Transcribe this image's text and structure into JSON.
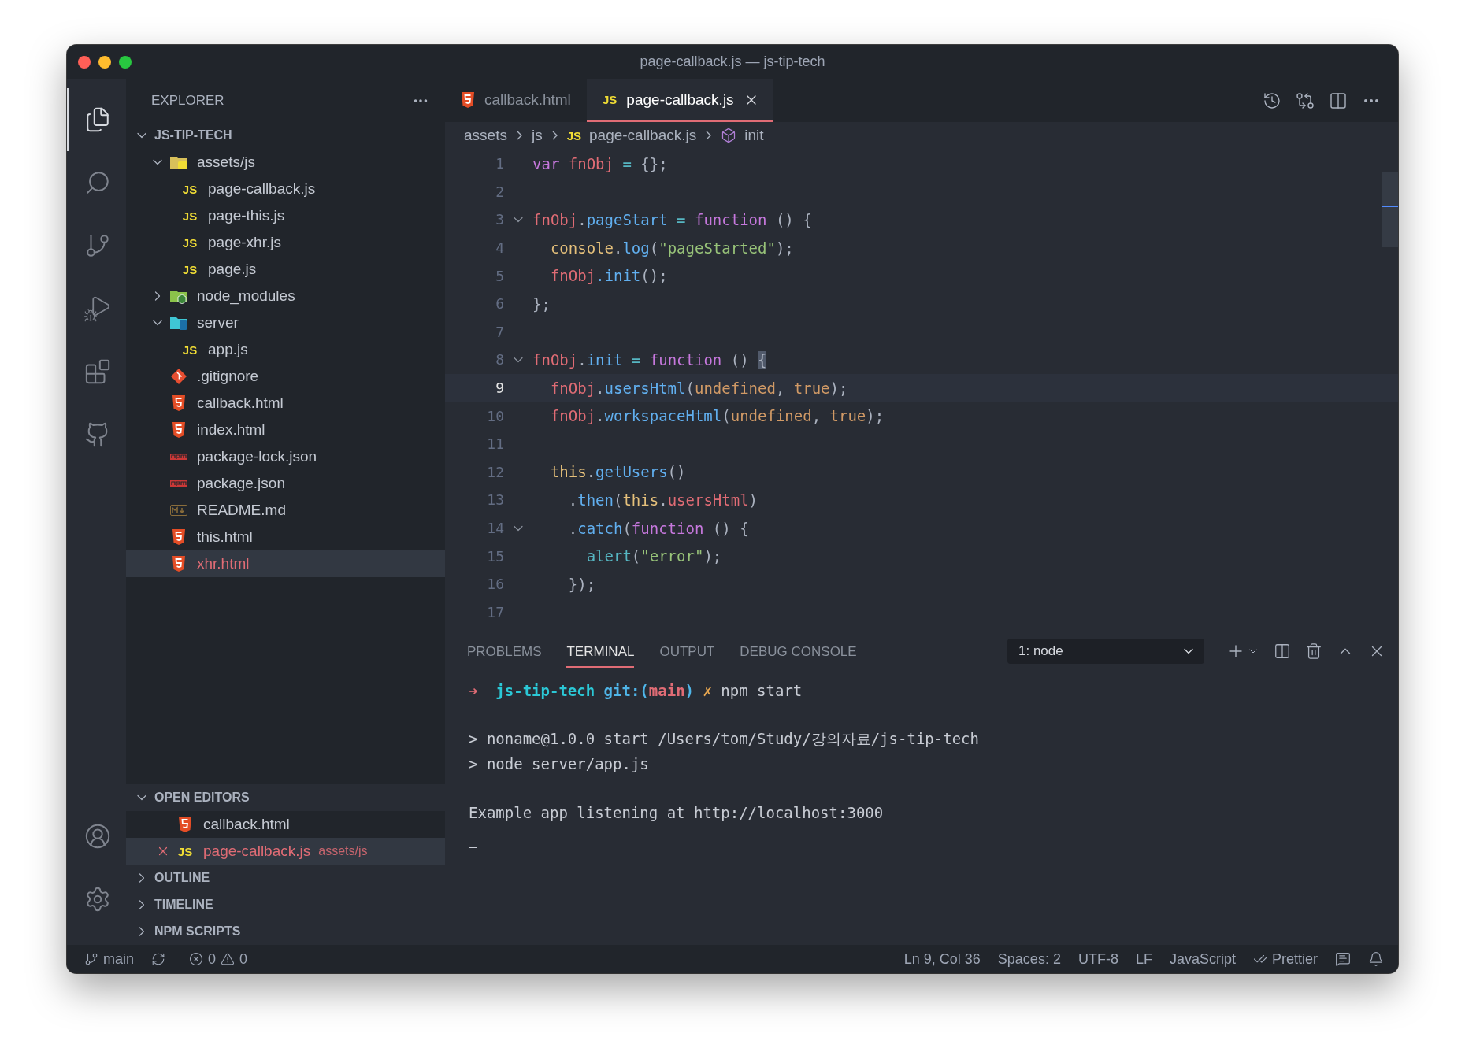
{
  "window": {
    "title": "page-callback.js — js-tip-tech"
  },
  "activity_bar": {
    "items": [
      {
        "kind": "explorer",
        "selected": true
      },
      {
        "kind": "search",
        "selected": false
      },
      {
        "kind": "source-control",
        "selected": false
      },
      {
        "kind": "run-debug",
        "selected": false
      },
      {
        "kind": "extensions",
        "selected": false
      },
      {
        "kind": "github",
        "selected": false
      }
    ],
    "bottom": [
      {
        "kind": "account"
      },
      {
        "kind": "settings"
      }
    ]
  },
  "sidebar": {
    "title": "EXPLORER",
    "root": {
      "label": "JS-TIP-TECH",
      "expanded": true
    },
    "tree": [
      {
        "label": "assets/js",
        "kind": "folder-js",
        "expanded": true,
        "selected": false,
        "errors": false,
        "children": [
          {
            "label": "page-callback.js",
            "kind": "js",
            "icon_label": "JS",
            "selected": false,
            "errors": false
          },
          {
            "label": "page-this.js",
            "kind": "js",
            "icon_label": "JS",
            "selected": false,
            "errors": false
          },
          {
            "label": "page-xhr.js",
            "kind": "js",
            "icon_label": "JS",
            "selected": false,
            "errors": false
          },
          {
            "label": "page.js",
            "kind": "js",
            "icon_label": "JS",
            "selected": false,
            "errors": false
          }
        ]
      },
      {
        "label": "node_modules",
        "kind": "folder-node",
        "expanded": false,
        "selected": false,
        "errors": false
      },
      {
        "label": "server",
        "kind": "folder-server",
        "expanded": true,
        "selected": false,
        "errors": false,
        "children": [
          {
            "label": "app.js",
            "kind": "js",
            "icon_label": "JS",
            "selected": false,
            "errors": false
          }
        ]
      },
      {
        "label": ".gitignore",
        "kind": "git",
        "selected": false,
        "errors": false
      },
      {
        "label": "callback.html",
        "kind": "html",
        "selected": false,
        "errors": false
      },
      {
        "label": "index.html",
        "kind": "html",
        "selected": false,
        "errors": false
      },
      {
        "label": "package-lock.json",
        "kind": "npm",
        "selected": false,
        "errors": false
      },
      {
        "label": "package.json",
        "kind": "npm",
        "selected": false,
        "errors": false
      },
      {
        "label": "README.md",
        "kind": "md",
        "selected": false,
        "errors": false
      },
      {
        "label": "this.html",
        "kind": "html",
        "selected": false,
        "errors": false
      },
      {
        "label": "xhr.html",
        "kind": "html",
        "selected": true,
        "errors": true
      }
    ],
    "open_editors": {
      "title": "OPEN EDITORS",
      "expanded": true,
      "items": [
        {
          "label": "callback.html",
          "kind": "html",
          "selected": false,
          "errors": false
        },
        {
          "label": "page-callback.js",
          "kind": "js",
          "icon_label": "JS",
          "description": "assets/js",
          "selected": true,
          "errors": true
        }
      ]
    },
    "sections": [
      {
        "title": "OUTLINE",
        "expanded": false
      },
      {
        "title": "TIMELINE",
        "expanded": false
      },
      {
        "title": "NPM SCRIPTS",
        "expanded": false
      }
    ]
  },
  "tabs": [
    {
      "label": "callback.html",
      "kind": "html",
      "selected": false
    },
    {
      "label": "page-callback.js",
      "kind": "js",
      "icon_label": "JS",
      "selected": true
    }
  ],
  "breadcrumb": [
    {
      "label": "assets",
      "kind": "folder"
    },
    {
      "label": "js",
      "kind": "folder"
    },
    {
      "label": "page-callback.js",
      "kind": "file",
      "icon_label": "JS"
    },
    {
      "label": "init",
      "kind": "symbol"
    }
  ],
  "code": [
    {
      "number": "1",
      "current": false,
      "foldable": false,
      "tokens": [
        {
          "text": "var ",
          "kind": "keyword"
        },
        {
          "text": "fnObj",
          "kind": "variable"
        },
        {
          "text": " = ",
          "kind": "operator"
        },
        {
          "text": "{};",
          "kind": "punct"
        }
      ]
    },
    {
      "number": "2",
      "current": false,
      "foldable": false
    },
    {
      "number": "3",
      "current": false,
      "foldable": true,
      "tokens": [
        {
          "text": "fnObj",
          "kind": "variable"
        },
        {
          "text": ".",
          "kind": "punct"
        },
        {
          "text": "pageStart",
          "kind": "method"
        },
        {
          "text": " = ",
          "kind": "operator"
        },
        {
          "text": "function",
          "kind": "keyword"
        },
        {
          "text": " () {",
          "kind": "punct"
        }
      ]
    },
    {
      "number": "4",
      "current": false,
      "foldable": false,
      "tokens": [
        {
          "text": "  console",
          "kind": "builtin"
        },
        {
          "text": ".",
          "kind": "punct"
        },
        {
          "text": "log",
          "kind": "method"
        },
        {
          "text": "(",
          "kind": "punct"
        },
        {
          "text": "\"pageStarted\"",
          "kind": "string"
        },
        {
          "text": ");",
          "kind": "punct"
        }
      ]
    },
    {
      "number": "5",
      "current": false,
      "foldable": false,
      "tokens": [
        {
          "text": "  fnObj",
          "kind": "variable"
        },
        {
          "text": ".init",
          "kind": "method"
        },
        {
          "text": "();",
          "kind": "punct"
        }
      ]
    },
    {
      "number": "6",
      "current": false,
      "foldable": false,
      "tokens": [
        {
          "text": "};",
          "kind": "punct"
        }
      ]
    },
    {
      "number": "7",
      "current": false,
      "foldable": false
    },
    {
      "number": "8",
      "current": false,
      "foldable": true,
      "tokens": [
        {
          "text": "fnObj",
          "kind": "variable"
        },
        {
          "text": ".",
          "kind": "punct"
        },
        {
          "text": "init",
          "kind": "method"
        },
        {
          "text": " = ",
          "kind": "operator"
        },
        {
          "text": "function",
          "kind": "keyword"
        },
        {
          "text": " () ",
          "kind": "punct"
        },
        {
          "text": "{",
          "kind": "brace-match"
        }
      ]
    },
    {
      "number": "9",
      "current": true,
      "foldable": false,
      "tokens": [
        {
          "text": "  fnObj",
          "kind": "variable"
        },
        {
          "text": ".",
          "kind": "punct"
        },
        {
          "text": "usersHtml",
          "kind": "method"
        },
        {
          "text": "(",
          "kind": "punct"
        },
        {
          "text": "undefined",
          "kind": "constant"
        },
        {
          "text": ", ",
          "kind": "punct"
        },
        {
          "text": "true",
          "kind": "constant"
        },
        {
          "text": ");",
          "kind": "punct"
        }
      ]
    },
    {
      "number": "10",
      "current": false,
      "foldable": false,
      "tokens": [
        {
          "text": "  fnObj",
          "kind": "variable"
        },
        {
          "text": ".",
          "kind": "punct"
        },
        {
          "text": "workspaceHtml",
          "kind": "method"
        },
        {
          "text": "(",
          "kind": "punct"
        },
        {
          "text": "undefined",
          "kind": "constant"
        },
        {
          "text": ", ",
          "kind": "punct"
        },
        {
          "text": "true",
          "kind": "constant"
        },
        {
          "text": ");",
          "kind": "punct"
        }
      ]
    },
    {
      "number": "11",
      "current": false,
      "foldable": false
    },
    {
      "number": "12",
      "current": false,
      "foldable": false,
      "tokens": [
        {
          "text": "  this",
          "kind": "builtin"
        },
        {
          "text": ".",
          "kind": "punct"
        },
        {
          "text": "getUsers",
          "kind": "method"
        },
        {
          "text": "()",
          "kind": "punct"
        }
      ]
    },
    {
      "number": "13",
      "current": false,
      "foldable": false,
      "tokens": [
        {
          "text": "    .",
          "kind": "punct"
        },
        {
          "text": "then",
          "kind": "method"
        },
        {
          "text": "(",
          "kind": "punct"
        },
        {
          "text": "this",
          "kind": "builtin"
        },
        {
          "text": ".",
          "kind": "punct"
        },
        {
          "text": "usersHtml",
          "kind": "variable"
        },
        {
          "text": ")",
          "kind": "punct"
        }
      ]
    },
    {
      "number": "14",
      "current": false,
      "foldable": true,
      "tokens": [
        {
          "text": "    .",
          "kind": "punct"
        },
        {
          "text": "catch",
          "kind": "method"
        },
        {
          "text": "(",
          "kind": "punct"
        },
        {
          "text": "function",
          "kind": "keyword"
        },
        {
          "text": " () {",
          "kind": "punct"
        }
      ]
    },
    {
      "number": "15",
      "current": false,
      "foldable": false,
      "tokens": [
        {
          "text": "      alert",
          "kind": "support"
        },
        {
          "text": "(",
          "kind": "punct"
        },
        {
          "text": "\"error\"",
          "kind": "string"
        },
        {
          "text": ");",
          "kind": "punct"
        }
      ]
    },
    {
      "number": "16",
      "current": false,
      "foldable": false,
      "tokens": [
        {
          "text": "    });",
          "kind": "punct"
        }
      ]
    },
    {
      "number": "17",
      "current": false,
      "foldable": false
    }
  ],
  "panel": {
    "tabs": [
      {
        "label": "PROBLEMS",
        "selected": false
      },
      {
        "label": "TERMINAL",
        "selected": true
      },
      {
        "label": "OUTPUT",
        "selected": false
      },
      {
        "label": "DEBUG CONSOLE",
        "selected": false
      }
    ],
    "terminal_select": "1: node",
    "terminal": [
      {
        "kind": "output",
        "segments": [
          {
            "text": "➜  ",
            "kind": "arrow"
          },
          {
            "text": "js-tip-tech ",
            "kind": "dir"
          },
          {
            "text": "git:(",
            "kind": "git"
          },
          {
            "text": "main",
            "kind": "branch"
          },
          {
            "text": ")",
            "kind": "git"
          },
          {
            "text": " ✗ ",
            "kind": "dirty"
          },
          {
            "text": "npm start",
            "kind": "plain"
          }
        ]
      },
      {
        "kind": "blank"
      },
      {
        "kind": "output",
        "segments": [
          {
            "text": "> noname@1.0.0 start /Users/tom/Study/강의자료/js-tip-tech",
            "kind": "plain"
          }
        ]
      },
      {
        "kind": "output",
        "segments": [
          {
            "text": "> node server/app.js",
            "kind": "plain"
          }
        ]
      },
      {
        "kind": "blank"
      },
      {
        "kind": "output",
        "segments": [
          {
            "text": "Example app listening at http://localhost:3000",
            "kind": "plain"
          }
        ]
      }
    ]
  },
  "status_bar": {
    "branch": "main",
    "errors": "0",
    "warnings": "0",
    "right": [
      {
        "text": "Ln 9, Col 36",
        "kind": "text"
      },
      {
        "text": "Spaces: 2",
        "kind": "text"
      },
      {
        "text": "UTF-8",
        "kind": "text"
      },
      {
        "text": "LF",
        "kind": "text"
      },
      {
        "text": "JavaScript",
        "kind": "text"
      },
      {
        "text": "Prettier",
        "kind": "check"
      }
    ]
  }
}
